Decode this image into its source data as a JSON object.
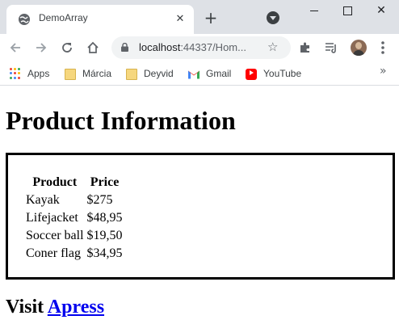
{
  "browser": {
    "tab_title": "DemoArray",
    "url_host": "localhost",
    "url_rest": ":44337/Hom...",
    "bookmarks": [
      {
        "label": "Apps",
        "icon": "apps-grid-icon"
      },
      {
        "label": "Márcia",
        "icon": "folder-icon"
      },
      {
        "label": "Deyvid",
        "icon": "folder-icon"
      },
      {
        "label": "Gmail",
        "icon": "gmail-icon"
      },
      {
        "label": "YouTube",
        "icon": "youtube-icon"
      }
    ],
    "bookmarks_more": "»",
    "new_tab_glyph": "+",
    "close_glyph": "✕"
  },
  "page": {
    "title": "Product Information",
    "table": {
      "headers": [
        "Product",
        "Price"
      ],
      "rows": [
        [
          "Kayak",
          "$275"
        ],
        [
          "Lifejacket",
          "$48,95"
        ],
        [
          "Soccer ball",
          "$19,50"
        ],
        [
          "Coner flag",
          "$34,95"
        ]
      ]
    },
    "visit_text": "Visit",
    "visit_link": "Apress"
  },
  "colors": {
    "chrome_bg": "#dee1e6",
    "omnibox_bg": "#f1f3f4",
    "link": "#0000ee"
  }
}
